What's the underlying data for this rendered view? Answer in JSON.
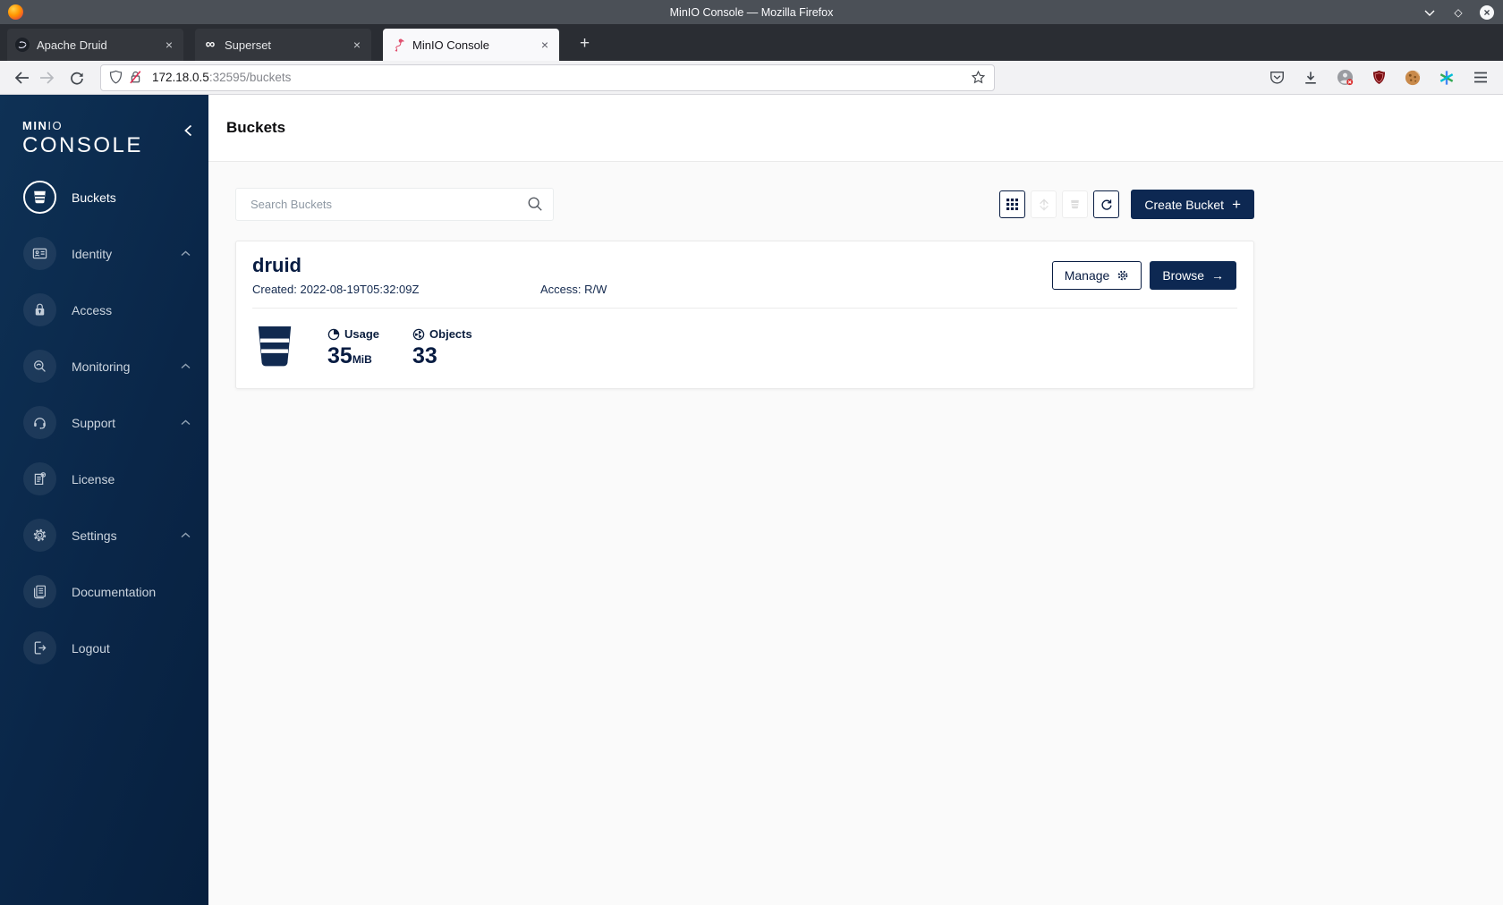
{
  "browser": {
    "window_title": "MinIO Console — Mozilla Firefox",
    "tabs": [
      {
        "label": "Apache Druid"
      },
      {
        "label": "Superset"
      },
      {
        "label": "MinIO Console"
      }
    ],
    "url": {
      "host": "172.18.0.5",
      "rest": ":32595/buckets"
    }
  },
  "icons": {
    "close": "×",
    "new_tab": "+",
    "maximize": "◇",
    "window_close": "×",
    "superset_glyph": "∞",
    "plus": "+",
    "arrow_right": "→"
  },
  "sidebar": {
    "logo_min": "MIN",
    "logo_io": "IO",
    "logo_console": "CONSOLE",
    "items": [
      {
        "label": "Buckets",
        "active": true
      },
      {
        "label": "Identity",
        "expandable": true
      },
      {
        "label": "Access"
      },
      {
        "label": "Monitoring",
        "expandable": true
      },
      {
        "label": "Support",
        "expandable": true
      },
      {
        "label": "License"
      },
      {
        "label": "Settings",
        "expandable": true
      },
      {
        "label": "Documentation"
      }
    ],
    "logout_label": "Logout"
  },
  "page": {
    "title": "Buckets"
  },
  "toolbar": {
    "search_placeholder": "Search Buckets",
    "create_button": "Create Bucket"
  },
  "bucket_card": {
    "name": "druid",
    "created": "Created: 2022-08-19T05:32:09Z",
    "access": "Access: R/W",
    "manage_label": "Manage",
    "browse_label": "Browse",
    "usage_label": "Usage",
    "usage_value": "35",
    "usage_unit": "MiB",
    "objects_label": "Objects",
    "objects_value": "33"
  },
  "colors": {
    "brand_navy": "#081C42",
    "flamingo_pink": "#e0506e",
    "insecure_red": "#e22850"
  }
}
